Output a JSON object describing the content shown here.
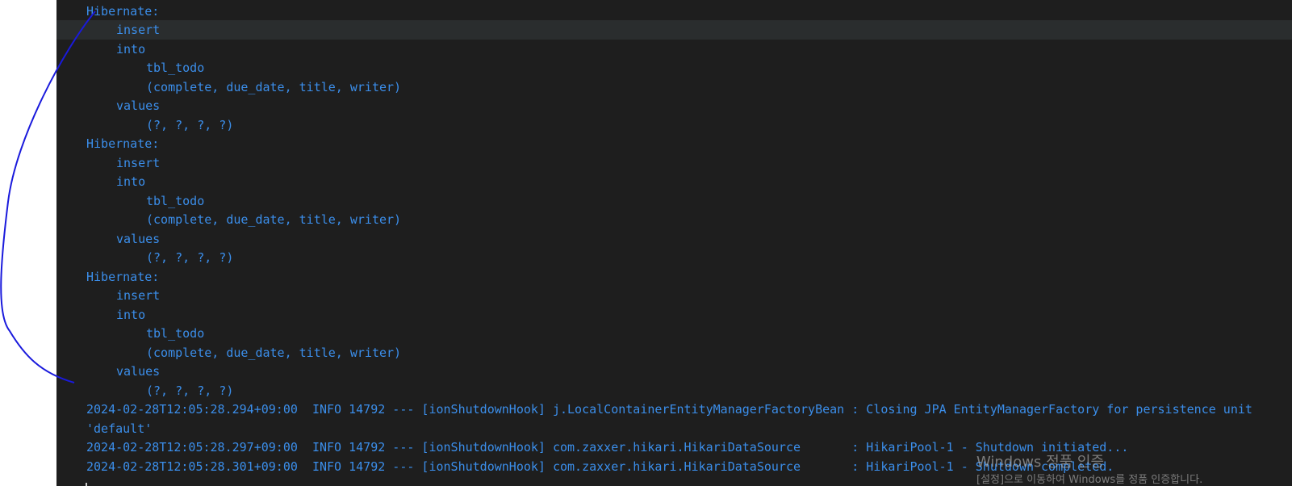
{
  "console": {
    "lines": [
      {
        "indent": 0,
        "text": "Hibernate:"
      },
      {
        "indent": 1,
        "text": "insert"
      },
      {
        "indent": 1,
        "text": "into"
      },
      {
        "indent": 2,
        "text": "tbl_todo"
      },
      {
        "indent": 2,
        "text": "(complete, due_date, title, writer)"
      },
      {
        "indent": 1,
        "text": "values"
      },
      {
        "indent": 2,
        "text": "(?, ?, ?, ?)"
      },
      {
        "indent": 0,
        "text": "Hibernate:"
      },
      {
        "indent": 1,
        "text": "insert"
      },
      {
        "indent": 1,
        "text": "into"
      },
      {
        "indent": 2,
        "text": "tbl_todo"
      },
      {
        "indent": 2,
        "text": "(complete, due_date, title, writer)"
      },
      {
        "indent": 1,
        "text": "values"
      },
      {
        "indent": 2,
        "text": "(?, ?, ?, ?)"
      },
      {
        "indent": 0,
        "text": "Hibernate:"
      },
      {
        "indent": 1,
        "text": "insert"
      },
      {
        "indent": 1,
        "text": "into"
      },
      {
        "indent": 2,
        "text": "tbl_todo"
      },
      {
        "indent": 2,
        "text": "(complete, due_date, title, writer)"
      },
      {
        "indent": 1,
        "text": "values"
      },
      {
        "indent": 2,
        "text": "(?, ?, ?, ?)"
      },
      {
        "indent": 0,
        "text": "2024-02-28T12:05:28.294+09:00  INFO 14792 --- [ionShutdownHook] j.LocalContainerEntityManagerFactoryBean : Closing JPA EntityManagerFactory for persistence unit"
      },
      {
        "indent": 0,
        "text": "'default'"
      },
      {
        "indent": 0,
        "text": "2024-02-28T12:05:28.297+09:00  INFO 14792 --- [ionShutdownHook] com.zaxxer.hikari.HikariDataSource       : HikariPool-1 - Shutdown initiated..."
      },
      {
        "indent": 0,
        "text": "2024-02-28T12:05:28.301+09:00  INFO 14792 --- [ionShutdownHook] com.zaxxer.hikari.HikariDataSource       : HikariPool-1 - Shutdown completed."
      }
    ]
  },
  "watermark": {
    "title": "Windows 정품 인증",
    "subtitle": "[설정]으로 이동하여 Windows를 정품 인증합니다."
  },
  "colors": {
    "console_bg": "#1e1e1e",
    "text": "#3b8eea",
    "active_line": "#2a2d2e",
    "annotation": "#1a1adc"
  }
}
